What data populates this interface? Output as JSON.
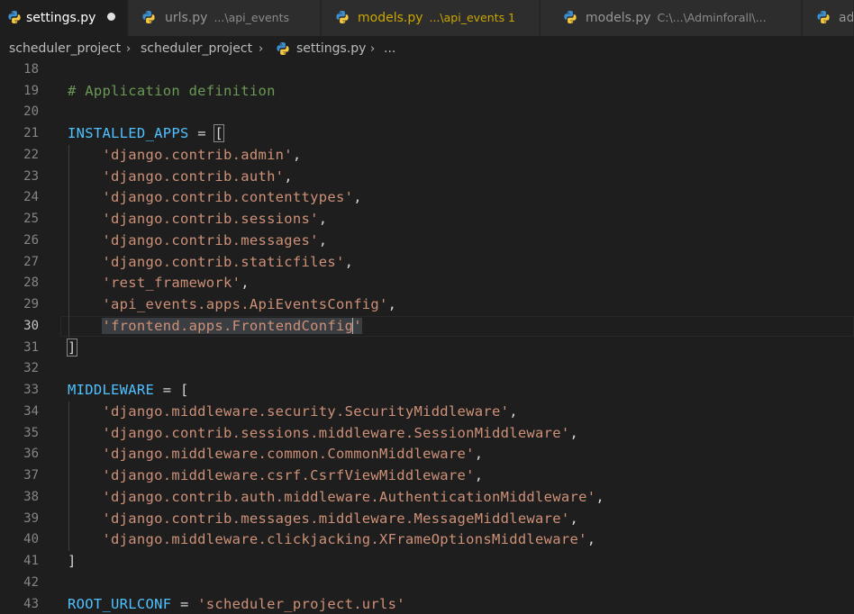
{
  "tabs": [
    {
      "label": "settings.py",
      "desc": "",
      "active": true,
      "dirty": true,
      "modified": false
    },
    {
      "label": "urls.py",
      "desc": "...\\api_events",
      "active": false,
      "dirty": false,
      "modified": false
    },
    {
      "label": "models.py",
      "desc": "...\\api_events 1",
      "active": false,
      "dirty": false,
      "modified": true
    },
    {
      "label": "models.py",
      "desc": "C:\\...\\Adminforall\\...",
      "active": false,
      "dirty": false,
      "modified": false
    },
    {
      "label": "ad",
      "desc": "",
      "active": false,
      "dirty": false,
      "modified": false
    }
  ],
  "breadcrumb": {
    "items": [
      "scheduler_project",
      "scheduler_project",
      "settings.py",
      "..."
    ],
    "separator": "›"
  },
  "editor": {
    "current_line": 30,
    "lines": [
      {
        "n": "18",
        "tokens": []
      },
      {
        "n": "19",
        "tokens": [
          {
            "t": "comment",
            "v": "# Application definition"
          }
        ]
      },
      {
        "n": "20",
        "tokens": []
      },
      {
        "n": "21",
        "tokens": [
          {
            "t": "var",
            "v": "INSTALLED_APPS"
          },
          {
            "t": "op",
            "v": " = "
          },
          {
            "t": "bracket",
            "v": "["
          }
        ]
      },
      {
        "n": "22",
        "guide": true,
        "tokens": [
          {
            "t": "str",
            "v": "    'django.contrib.admin'"
          },
          {
            "t": "punct",
            "v": ","
          }
        ]
      },
      {
        "n": "23",
        "guide": true,
        "tokens": [
          {
            "t": "str",
            "v": "    'django.contrib.auth'"
          },
          {
            "t": "punct",
            "v": ","
          }
        ]
      },
      {
        "n": "24",
        "guide": true,
        "tokens": [
          {
            "t": "str",
            "v": "    'django.contrib.contenttypes'"
          },
          {
            "t": "punct",
            "v": ","
          }
        ]
      },
      {
        "n": "25",
        "guide": true,
        "tokens": [
          {
            "t": "str",
            "v": "    'django.contrib.sessions'"
          },
          {
            "t": "punct",
            "v": ","
          }
        ]
      },
      {
        "n": "26",
        "guide": true,
        "tokens": [
          {
            "t": "str",
            "v": "    'django.contrib.messages'"
          },
          {
            "t": "punct",
            "v": ","
          }
        ]
      },
      {
        "n": "27",
        "guide": true,
        "tokens": [
          {
            "t": "str",
            "v": "    'django.contrib.staticfiles'"
          },
          {
            "t": "punct",
            "v": ","
          }
        ]
      },
      {
        "n": "28",
        "guide": true,
        "tokens": [
          {
            "t": "str",
            "v": "    'rest_framework'"
          },
          {
            "t": "punct",
            "v": ","
          }
        ]
      },
      {
        "n": "29",
        "guide": true,
        "tokens": [
          {
            "t": "str",
            "v": "    'api_events.apps.ApiEventsConfig'"
          },
          {
            "t": "punct",
            "v": ","
          }
        ]
      },
      {
        "n": "30",
        "guide": true,
        "tokens": [
          {
            "t": "op",
            "v": "    "
          },
          {
            "t": "selstr",
            "v": "'frontend.apps.FrontendConfig"
          },
          {
            "t": "cursor",
            "v": ""
          },
          {
            "t": "selstr",
            "v": "'"
          }
        ]
      },
      {
        "n": "31",
        "tokens": [
          {
            "t": "bracket",
            "v": "]"
          }
        ]
      },
      {
        "n": "32",
        "tokens": []
      },
      {
        "n": "33",
        "tokens": [
          {
            "t": "var",
            "v": "MIDDLEWARE"
          },
          {
            "t": "op",
            "v": " = "
          },
          {
            "t": "punct",
            "v": "["
          }
        ]
      },
      {
        "n": "34",
        "guide": true,
        "tokens": [
          {
            "t": "str",
            "v": "    'django.middleware.security.SecurityMiddleware'"
          },
          {
            "t": "punct",
            "v": ","
          }
        ]
      },
      {
        "n": "35",
        "guide": true,
        "tokens": [
          {
            "t": "str",
            "v": "    'django.contrib.sessions.middleware.SessionMiddleware'"
          },
          {
            "t": "punct",
            "v": ","
          }
        ]
      },
      {
        "n": "36",
        "guide": true,
        "tokens": [
          {
            "t": "str",
            "v": "    'django.middleware.common.CommonMiddleware'"
          },
          {
            "t": "punct",
            "v": ","
          }
        ]
      },
      {
        "n": "37",
        "guide": true,
        "tokens": [
          {
            "t": "str",
            "v": "    'django.middleware.csrf.CsrfViewMiddleware'"
          },
          {
            "t": "punct",
            "v": ","
          }
        ]
      },
      {
        "n": "38",
        "guide": true,
        "tokens": [
          {
            "t": "str",
            "v": "    'django.contrib.auth.middleware.AuthenticationMiddleware'"
          },
          {
            "t": "punct",
            "v": ","
          }
        ]
      },
      {
        "n": "39",
        "guide": true,
        "tokens": [
          {
            "t": "str",
            "v": "    'django.contrib.messages.middleware.MessageMiddleware'"
          },
          {
            "t": "punct",
            "v": ","
          }
        ]
      },
      {
        "n": "40",
        "guide": true,
        "tokens": [
          {
            "t": "str",
            "v": "    'django.middleware.clickjacking.XFrameOptionsMiddleware'"
          },
          {
            "t": "punct",
            "v": ","
          }
        ]
      },
      {
        "n": "41",
        "tokens": [
          {
            "t": "punct",
            "v": "]"
          }
        ]
      },
      {
        "n": "42",
        "tokens": []
      },
      {
        "n": "43",
        "tokens": [
          {
            "t": "var",
            "v": "ROOT_URLCONF"
          },
          {
            "t": "op",
            "v": " = "
          },
          {
            "t": "str",
            "v": "'scheduler_project.urls'"
          }
        ]
      }
    ]
  },
  "colors": {
    "python_icon_blue": "#3b8ed0",
    "python_icon_yellow": "#f5c842",
    "comment": "#6a9955",
    "variable": "#4fc1ff",
    "string": "#ce9178"
  }
}
